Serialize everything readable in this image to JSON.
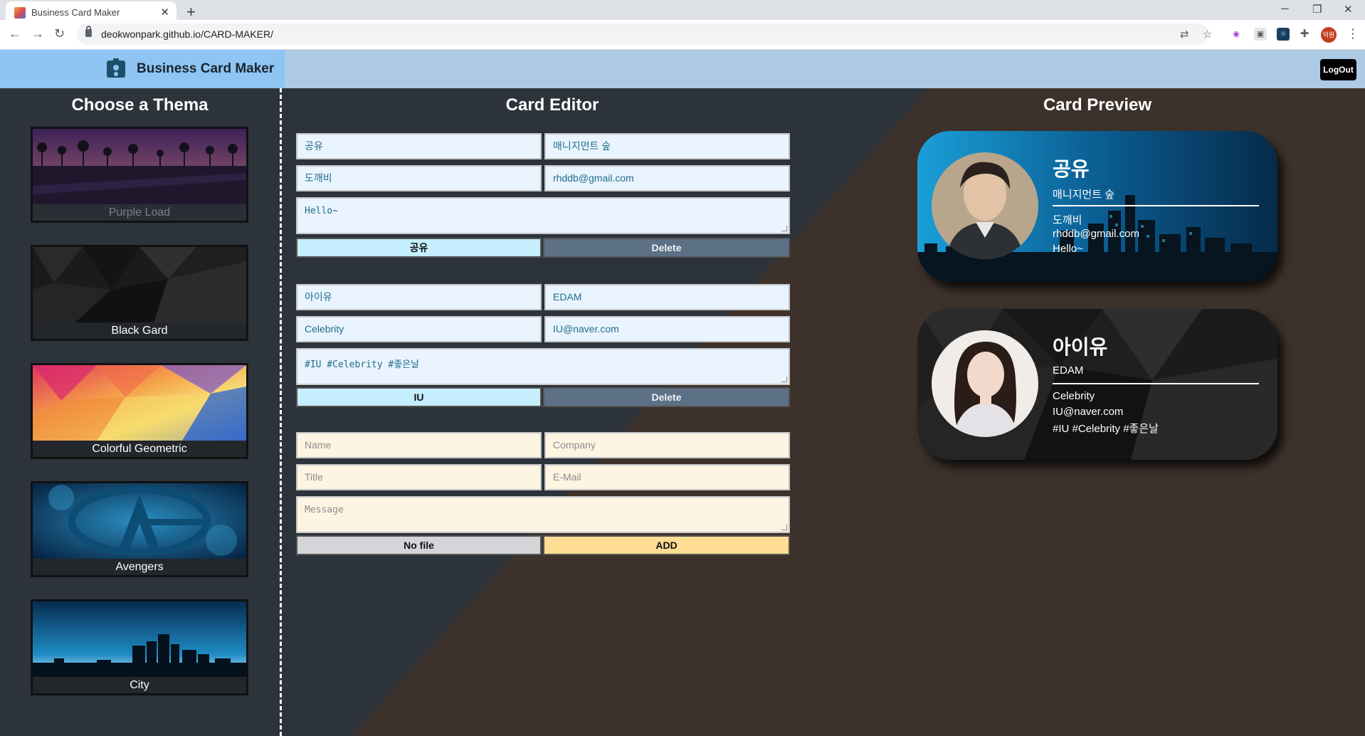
{
  "browser": {
    "tab_title": "Business Card Maker",
    "url": "deokwonpark.github.io/CARD-MAKER/",
    "profile_initials": "덕원"
  },
  "header": {
    "title": "Business Card Maker",
    "logout_label": "LogOut"
  },
  "themes_panel": {
    "title": "Choose a Thema",
    "themes": [
      {
        "label": "Purple Load"
      },
      {
        "label": "Black Gard"
      },
      {
        "label": "Colorful Geometric"
      },
      {
        "label": "Avengers"
      },
      {
        "label": "City"
      }
    ]
  },
  "editor": {
    "title": "Card Editor",
    "cards": [
      {
        "name": "공유",
        "company": "매니지먼트 숲",
        "title": "도깨비",
        "email": "rhddb@gmail.com",
        "message": "Hello~",
        "file_label": "공유",
        "delete_label": "Delete"
      },
      {
        "name": "아이유",
        "company": "EDAM",
        "title": "Celebrity",
        "email": "IU@naver.com",
        "message": "#IU #Celebrity #좋은날",
        "file_label": "IU",
        "delete_label": "Delete"
      }
    ],
    "add_form": {
      "name_placeholder": "Name",
      "company_placeholder": "Company",
      "title_placeholder": "Title",
      "email_placeholder": "E-Mail",
      "message_placeholder": "Message",
      "file_label": "No file",
      "add_label": "ADD"
    }
  },
  "preview": {
    "title": "Card Preview",
    "cards": [
      {
        "name": "공유",
        "company": "매니지먼트 숲",
        "title": "도깨비",
        "email": "rhddb@gmail.com",
        "message": "Hello~",
        "theme": "City"
      },
      {
        "name": "아이유",
        "company": "EDAM",
        "title": "Celebrity",
        "email": "IU@naver.com",
        "message": "#IU #Celebrity #좋은날",
        "theme": "Black Gard"
      }
    ]
  },
  "colors": {
    "brand_bg": "#8ec5f2",
    "header_bg": "#aecbe6",
    "editor_bg": "#2d333b",
    "preview_bg": "#3d322b",
    "field_bg": "#eaf4ff",
    "add_field_bg": "#fdf5e2",
    "add_button": "#ffdd94",
    "delete_button": "#5d7186"
  }
}
